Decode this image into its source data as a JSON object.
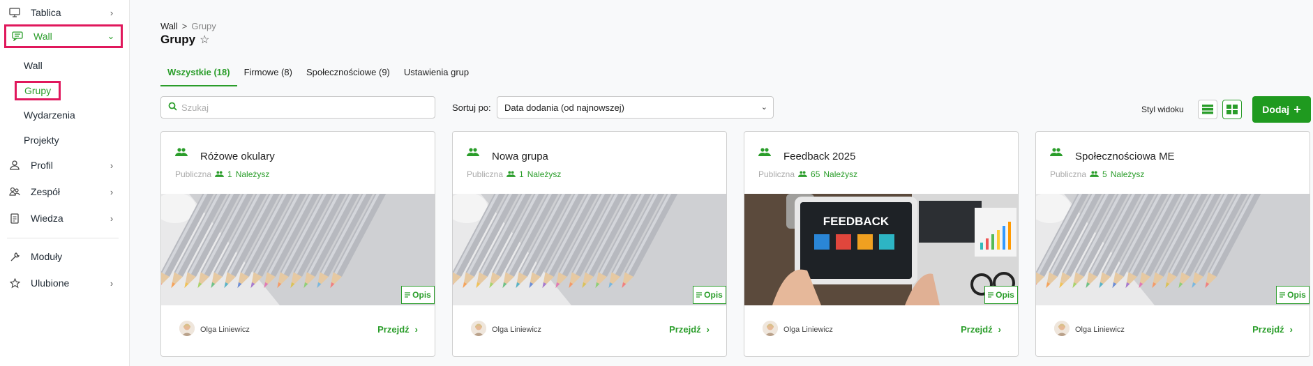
{
  "sidebar": {
    "items": [
      {
        "label": "Tablica",
        "icon": "monitor-icon"
      },
      {
        "label": "Wall",
        "icon": "chat-icon"
      },
      {
        "label": "Profil",
        "icon": "user-icon"
      },
      {
        "label": "Zespół",
        "icon": "team-icon"
      },
      {
        "label": "Wiedza",
        "icon": "book-icon"
      },
      {
        "label": "Moduły",
        "icon": "wrench-icon"
      },
      {
        "label": "Ulubione",
        "icon": "star-icon"
      }
    ],
    "wall_sub": [
      "Wall",
      "Grupy",
      "Wydarzenia",
      "Projekty"
    ]
  },
  "breadcrumb": {
    "root": "Wall",
    "sep": ">",
    "current": "Grupy"
  },
  "page_title": "Grupy",
  "tabs": [
    {
      "label": "Wszystkie (18)"
    },
    {
      "label": "Firmowe (8)"
    },
    {
      "label": "Społecznościowe (9)"
    },
    {
      "label": "Ustawienia grup"
    }
  ],
  "search": {
    "placeholder": "Szukaj"
  },
  "sort": {
    "label": "Sortuj po:",
    "value": "Data dodania (od najnowszej)"
  },
  "view": {
    "label": "Styl widoku"
  },
  "add_button": {
    "label": "Dodaj"
  },
  "cards": [
    {
      "title": "Różowe okulary",
      "visibility": "Publiczna",
      "members": "1",
      "status": "Należysz",
      "image": "pencils",
      "opis": "Opis",
      "author": "Olga Liniewicz",
      "go": "Przejdź"
    },
    {
      "title": "Nowa grupa",
      "visibility": "Publiczna",
      "members": "1",
      "status": "Należysz",
      "image": "pencils",
      "opis": "Opis",
      "author": "Olga Liniewicz",
      "go": "Przejdź"
    },
    {
      "title": "Feedback 2025",
      "visibility": "Publiczna",
      "members": "65",
      "status": "Należysz",
      "image": "feedback",
      "image_text": "FEEDBACK",
      "opis": "Opis",
      "author": "Olga Liniewicz",
      "go": "Przejdź"
    },
    {
      "title": "Społecznościowa ME",
      "visibility": "Publiczna",
      "members": "5",
      "status": "Należysz",
      "image": "pencils",
      "opis": "Opis",
      "author": "Olga Liniewicz",
      "go": "Przejdź"
    }
  ],
  "colors": {
    "accent": "#2a9d2a",
    "highlight": "#e0185c",
    "add_button_bg": "#1f9a1f"
  }
}
